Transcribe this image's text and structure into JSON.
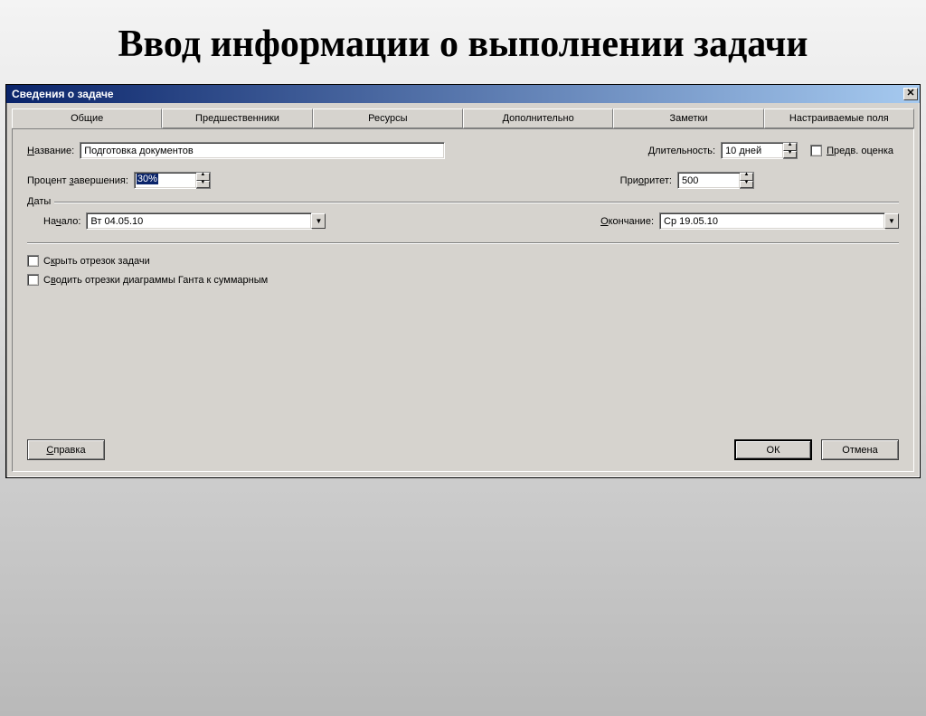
{
  "slide": {
    "title": "Ввод информации о выполнении задачи"
  },
  "dialog": {
    "title": "Сведения о задаче",
    "tabs": [
      "Общие",
      "Предшественники",
      "Ресурсы",
      "Дополнительно",
      "Заметки",
      "Настраиваемые поля"
    ],
    "active_tab_index": 0
  },
  "fields": {
    "name_label": "Название:",
    "name_value": "Подготовка документов",
    "duration_label": "Длительность:",
    "duration_value": "10 дней",
    "estimate_label": "Предв. оценка",
    "percent_label": "Процент завершения:",
    "percent_value": "30%",
    "priority_label": "Приоритет:",
    "priority_value": "500",
    "dates_legend": "Даты",
    "start_label": "Начало:",
    "start_value": "Вт 04.05.10",
    "finish_label": "Окончание:",
    "finish_value": "Ср 19.05.10",
    "hide_bar_label": "Скрыть отрезок задачи",
    "rollup_label": "Сводить отрезки диаграммы Ганта к суммарным"
  },
  "buttons": {
    "help": "Справка",
    "ok": "ОК",
    "cancel": "Отмена"
  },
  "underline": {
    "name": "Н",
    "duration": "Д",
    "estimate": "П",
    "percent": "з",
    "priority": "о",
    "start": "ч",
    "finish": "О",
    "hide": "к",
    "rollup": "в",
    "help": "С"
  }
}
